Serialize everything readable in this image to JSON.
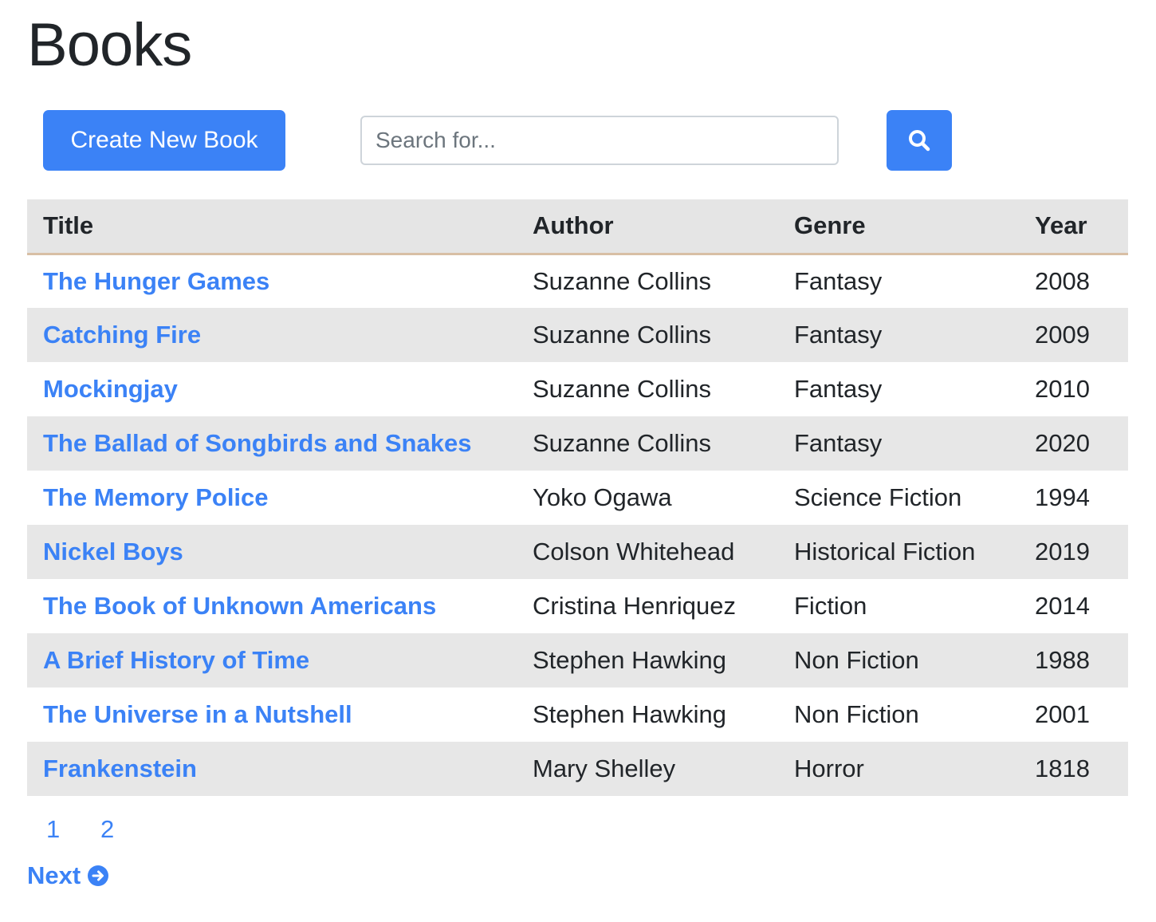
{
  "page": {
    "title": "Books"
  },
  "toolbar": {
    "create_label": "Create New Book",
    "search_placeholder": "Search for...",
    "search_value": "",
    "search_icon": "search-icon",
    "accent_color": "#3b82f6"
  },
  "table": {
    "headers": {
      "title": "Title",
      "author": "Author",
      "genre": "Genre",
      "year": "Year"
    },
    "rows": [
      {
        "title": "The Hunger Games",
        "author": "Suzanne Collins",
        "genre": "Fantasy",
        "year": "2008"
      },
      {
        "title": "Catching Fire",
        "author": "Suzanne Collins",
        "genre": "Fantasy",
        "year": "2009"
      },
      {
        "title": "Mockingjay",
        "author": "Suzanne Collins",
        "genre": "Fantasy",
        "year": "2010"
      },
      {
        "title": "The Ballad of Songbirds and Snakes",
        "author": "Suzanne Collins",
        "genre": "Fantasy",
        "year": "2020"
      },
      {
        "title": "The Memory Police",
        "author": "Yoko Ogawa",
        "genre": "Science Fiction",
        "year": "1994"
      },
      {
        "title": "Nickel Boys",
        "author": "Colson Whitehead",
        "genre": "Historical Fiction",
        "year": "2019"
      },
      {
        "title": "The Book of Unknown Americans",
        "author": "Cristina Henriquez",
        "genre": "Fiction",
        "year": "2014"
      },
      {
        "title": "A Brief History of Time",
        "author": "Stephen Hawking",
        "genre": "Non Fiction",
        "year": "1988"
      },
      {
        "title": "The Universe in a Nutshell",
        "author": "Stephen Hawking",
        "genre": "Non Fiction",
        "year": "2001"
      },
      {
        "title": "Frankenstein",
        "author": "Mary Shelley",
        "genre": "Horror",
        "year": "1818"
      }
    ]
  },
  "pagination": {
    "pages": [
      "1",
      "2"
    ],
    "next_label": "Next",
    "next_icon": "arrow-right-circle-icon"
  }
}
